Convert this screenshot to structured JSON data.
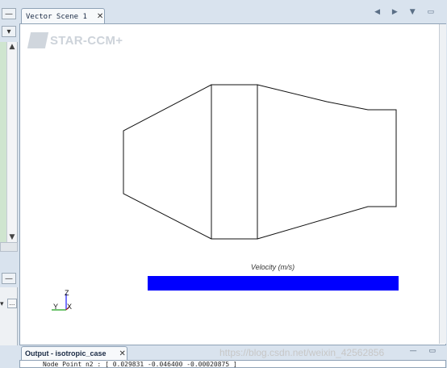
{
  "scene_tab": {
    "title": "Vector Scene 1",
    "close": "✕"
  },
  "nav": {
    "arrows": "◀ ▶ ▼ ▭"
  },
  "logo": {
    "text": "STAR-CCM+"
  },
  "legend": {
    "label": "Velocity (m/s)",
    "color": "#0000ff"
  },
  "axes": {
    "z": "Z",
    "y": "Y",
    "x": "X"
  },
  "left_panel": {
    "minus1": "—",
    "dropdown": "▾",
    "up": "▲",
    "down": "▼",
    "minus2": "—",
    "dots": "...",
    "chev": "▾"
  },
  "output": {
    "tab_title": "Output - isotropic_case",
    "close": "✕",
    "line": "Node Point n2 : [ 0.029831 -0.046400 -0.00020875 ]",
    "controls": "— ▭"
  },
  "watermark": "https://blog.csdn.net/weixin_42562856"
}
